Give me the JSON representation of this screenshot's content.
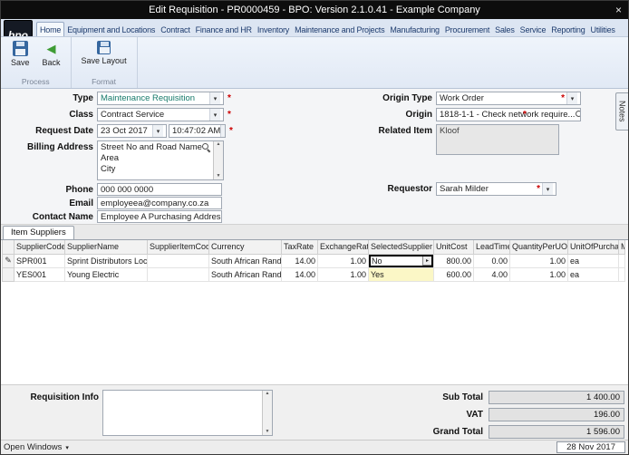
{
  "colors": {
    "titlebar_bg": "#0d0d0d",
    "required_red": "#cc0000",
    "type_value_teal": "#177a6b",
    "selected_yes_bg": "#fbf7c6",
    "logo_accent_orange": "#e07b20"
  },
  "window": {
    "title": "Edit Requisition - PR0000459 - BPO: Version 2.1.0.41 - Example Company"
  },
  "logo_text": "bpo",
  "ribbon": {
    "tabs": [
      "Home",
      "Equipment and Locations",
      "Contract",
      "Finance and HR",
      "Inventory",
      "Maintenance and Projects",
      "Manufacturing",
      "Procurement",
      "Sales",
      "Service",
      "Reporting",
      "Utilities"
    ],
    "active_tab": "Home",
    "save_label": "Save",
    "back_label": "Back",
    "save_layout_label": "Save Layout",
    "group_process": "Process",
    "group_format": "Format"
  },
  "form": {
    "required_marker": "*",
    "type_label": "Type",
    "type_value": "Maintenance Requisition",
    "class_label": "Class",
    "class_value": "Contract Service",
    "request_date_label": "Request Date",
    "request_date_value": "23 Oct 2017",
    "request_time_value": "10:47:02 AM",
    "billing_address_label": "Billing Address",
    "billing_address_lines": [
      "Street No and Road Name",
      "Area",
      "City"
    ],
    "phone_label": "Phone",
    "phone_value": "000 000 0000",
    "email_label": "Email",
    "email_value": "employeea@company.co.za",
    "contact_name_label": "Contact Name",
    "contact_name_value": "Employee A Purchasing Address",
    "origin_type_label": "Origin Type",
    "origin_type_value": "Work Order",
    "origin_label": "Origin",
    "origin_value": "1818-1-1 - Check network require...",
    "related_item_label": "Related Item",
    "related_item_value": "Kloof",
    "requestor_label": "Requestor",
    "requestor_value": "Sarah Milder",
    "notes_tab": "Notes"
  },
  "grid": {
    "tab_label": "Item Suppliers",
    "columns": [
      "",
      "SupplierCode",
      "SupplierName",
      "SupplierItemCode",
      "Currency",
      "TaxRate",
      "ExchangeRate",
      "SelectedSupplier",
      "UnitCost",
      "LeadTime",
      "QuantityPerUOP",
      "UnitOfPurchase",
      "Mi"
    ],
    "rows": [
      {
        "supplier_code": "SPR001",
        "supplier_name": "Sprint Distributors Local",
        "supplier_item_code": "",
        "currency": "South African Rand",
        "tax_rate": "14.00",
        "exchange_rate": "1.00",
        "selected_supplier": "No",
        "unit_cost": "800.00",
        "lead_time": "0.00",
        "quantity_per_uop": "1.00",
        "unit_of_purchase": "ea",
        "mi": ""
      },
      {
        "supplier_code": "YES001",
        "supplier_name": "Young Electric",
        "supplier_item_code": "",
        "currency": "South African Rand",
        "tax_rate": "14.00",
        "exchange_rate": "1.00",
        "selected_supplier": "Yes",
        "unit_cost": "600.00",
        "lead_time": "4.00",
        "quantity_per_uop": "1.00",
        "unit_of_purchase": "ea",
        "mi": ""
      }
    ]
  },
  "footer": {
    "requisition_info_label": "Requisition Info",
    "sub_total_label": "Sub Total",
    "sub_total_value": "1 400.00",
    "vat_label": "VAT",
    "vat_value": "196.00",
    "grand_total_label": "Grand Total",
    "grand_total_value": "1 596.00"
  },
  "statusbar": {
    "open_windows_label": "Open Windows",
    "date": "28 Nov 2017"
  }
}
